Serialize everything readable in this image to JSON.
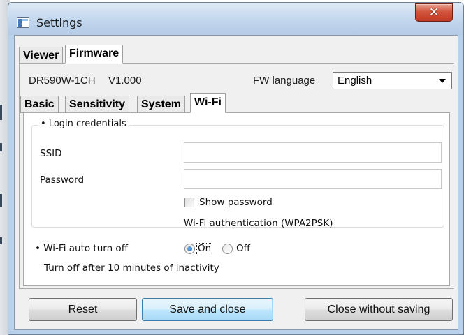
{
  "window": {
    "title": "Settings"
  },
  "main_tabs": [
    {
      "label": "Viewer",
      "active": false
    },
    {
      "label": "Firmware",
      "active": true
    }
  ],
  "device": {
    "model": "DR590W-1CH",
    "version": "V1.000"
  },
  "fw_language": {
    "label": "FW language",
    "value": "English"
  },
  "sub_tabs": [
    {
      "label": "Basic",
      "active": false
    },
    {
      "label": "Sensitivity",
      "active": false
    },
    {
      "label": "System",
      "active": false
    },
    {
      "label": "Wi-Fi",
      "active": true
    }
  ],
  "wifi": {
    "login_title": "• Login credentials",
    "ssid_label": "SSID",
    "ssid_value": "",
    "password_label": "Password",
    "password_value": "",
    "show_password_label": "Show password",
    "show_password_checked": false,
    "auth_text": "Wi-Fi authentication (WPA2PSK)",
    "auto_off_label": "• Wi-Fi auto turn off",
    "on_label": "On",
    "off_label": "Off",
    "selected": "On",
    "auto_off_note": "Turn off after 10 minutes of inactivity"
  },
  "buttons": {
    "reset": "Reset",
    "save_close": "Save and close",
    "close_no_save": "Close without saving"
  },
  "icons": {
    "close": "close-icon",
    "app": "settings-window-icon"
  },
  "colors": {
    "title_bar": "#c4d8ee",
    "close_button": "#c94530",
    "default_button_border": "#3c7fb1"
  }
}
